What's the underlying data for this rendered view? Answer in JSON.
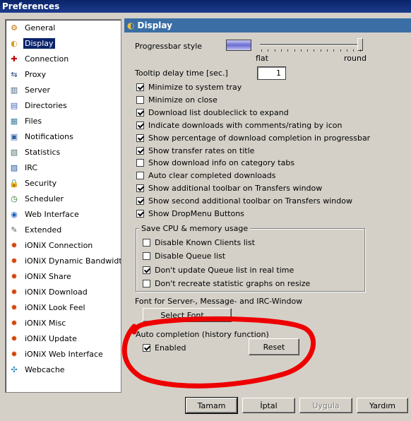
{
  "window": {
    "title": "Preferences"
  },
  "sidebar": {
    "items": [
      {
        "label": "General",
        "icon": "gear-icon",
        "glyph": "⚙",
        "color": "#c07000"
      },
      {
        "label": "Display",
        "icon": "display-icon",
        "glyph": "◐",
        "color": "#d4a020",
        "selected": true
      },
      {
        "label": "Connection",
        "icon": "connection-icon",
        "glyph": "✚",
        "color": "#c00000"
      },
      {
        "label": "Proxy",
        "icon": "proxy-icon",
        "glyph": "⇆",
        "color": "#204080"
      },
      {
        "label": "Server",
        "icon": "server-icon",
        "glyph": "▥",
        "color": "#406080"
      },
      {
        "label": "Directories",
        "icon": "folder-icon",
        "glyph": "▤",
        "color": "#4060c0"
      },
      {
        "label": "Files",
        "icon": "files-icon",
        "glyph": "▦",
        "color": "#4080a0"
      },
      {
        "label": "Notifications",
        "icon": "notification-icon",
        "glyph": "▣",
        "color": "#3060a0"
      },
      {
        "label": "Statistics",
        "icon": "statistics-icon",
        "glyph": "▧",
        "color": "#507070"
      },
      {
        "label": "IRC",
        "icon": "irc-icon",
        "glyph": "▨",
        "color": "#2050a0"
      },
      {
        "label": "Security",
        "icon": "lock-icon",
        "glyph": "🔒",
        "color": "#c09000"
      },
      {
        "label": "Scheduler",
        "icon": "clock-icon",
        "glyph": "◷",
        "color": "#207020"
      },
      {
        "label": "Web Interface",
        "icon": "globe-icon",
        "glyph": "◉",
        "color": "#2060c0"
      },
      {
        "label": "Extended",
        "icon": "wrench-icon",
        "glyph": "✎",
        "color": "#606060"
      },
      {
        "label": "iONiX Connection",
        "icon": "ionix-icon",
        "glyph": "✹",
        "color": "#d04000"
      },
      {
        "label": "iONiX Dynamic Bandwidth",
        "icon": "ionix-icon",
        "glyph": "✹",
        "color": "#d04000"
      },
      {
        "label": "iONiX Share",
        "icon": "ionix-icon",
        "glyph": "✹",
        "color": "#d04000"
      },
      {
        "label": "iONiX Download",
        "icon": "ionix-icon",
        "glyph": "✹",
        "color": "#d04000"
      },
      {
        "label": "iONiX Look  Feel",
        "icon": "ionix-icon",
        "glyph": "✹",
        "color": "#d04000"
      },
      {
        "label": "iONiX Misc",
        "icon": "ionix-icon",
        "glyph": "✹",
        "color": "#d04000"
      },
      {
        "label": "iONiX Update",
        "icon": "ionix-icon",
        "glyph": "✹",
        "color": "#d04000"
      },
      {
        "label": "iONiX Web Interface",
        "icon": "ionix-icon",
        "glyph": "✹",
        "color": "#d04000"
      },
      {
        "label": "Webcache",
        "icon": "webcache-icon",
        "glyph": "✣",
        "color": "#2080c0"
      }
    ]
  },
  "panel": {
    "title": "Display",
    "progressbar": {
      "label": "Progressbar style",
      "min_label": "flat",
      "max_label": "round",
      "value_fraction": 1.0
    },
    "tooltip": {
      "label": "Tooltip delay time [sec.]",
      "value": "1"
    },
    "options": [
      {
        "label": "Minimize to system tray",
        "checked": true
      },
      {
        "label": "Minimize on close",
        "checked": false
      },
      {
        "label": "Download list doubleclick to expand",
        "checked": true
      },
      {
        "label": "Indicate downloads with comments/rating by icon",
        "checked": true
      },
      {
        "label": "Show percentage of download completion in progressbar",
        "checked": true
      },
      {
        "label": "Show transfer rates on title",
        "checked": true
      },
      {
        "label": "Show download info on category tabs",
        "checked": false
      },
      {
        "label": "Auto clear completed downloads",
        "checked": false
      },
      {
        "label": "Show additional toolbar on Transfers window",
        "checked": true
      },
      {
        "label": "Show second additional toolbar on Transfers window",
        "checked": true
      },
      {
        "label": "Show DropMenu Buttons",
        "checked": true
      }
    ],
    "cpu_group": {
      "title": "Save CPU & memory usage",
      "options": [
        {
          "label": "Disable Known Clients list",
          "checked": false
        },
        {
          "label": "Disable Queue list",
          "checked": false
        },
        {
          "label": "Don't update Queue list in real time",
          "checked": true
        },
        {
          "label": "Don't recreate statistic graphs on resize",
          "checked": false
        }
      ]
    },
    "font": {
      "label": "Font for Server-, Message- and IRC-Window",
      "button": "Select Font ..."
    },
    "autocomplete": {
      "title": "Auto completion (history function)",
      "enabled_label": "Enabled",
      "enabled_checked": true,
      "reset_button": "Reset"
    }
  },
  "footer": {
    "ok": "Tamam",
    "cancel": "İptal",
    "apply": "Uygula",
    "help": "Yardım"
  },
  "annotation_color": "#ee0000"
}
